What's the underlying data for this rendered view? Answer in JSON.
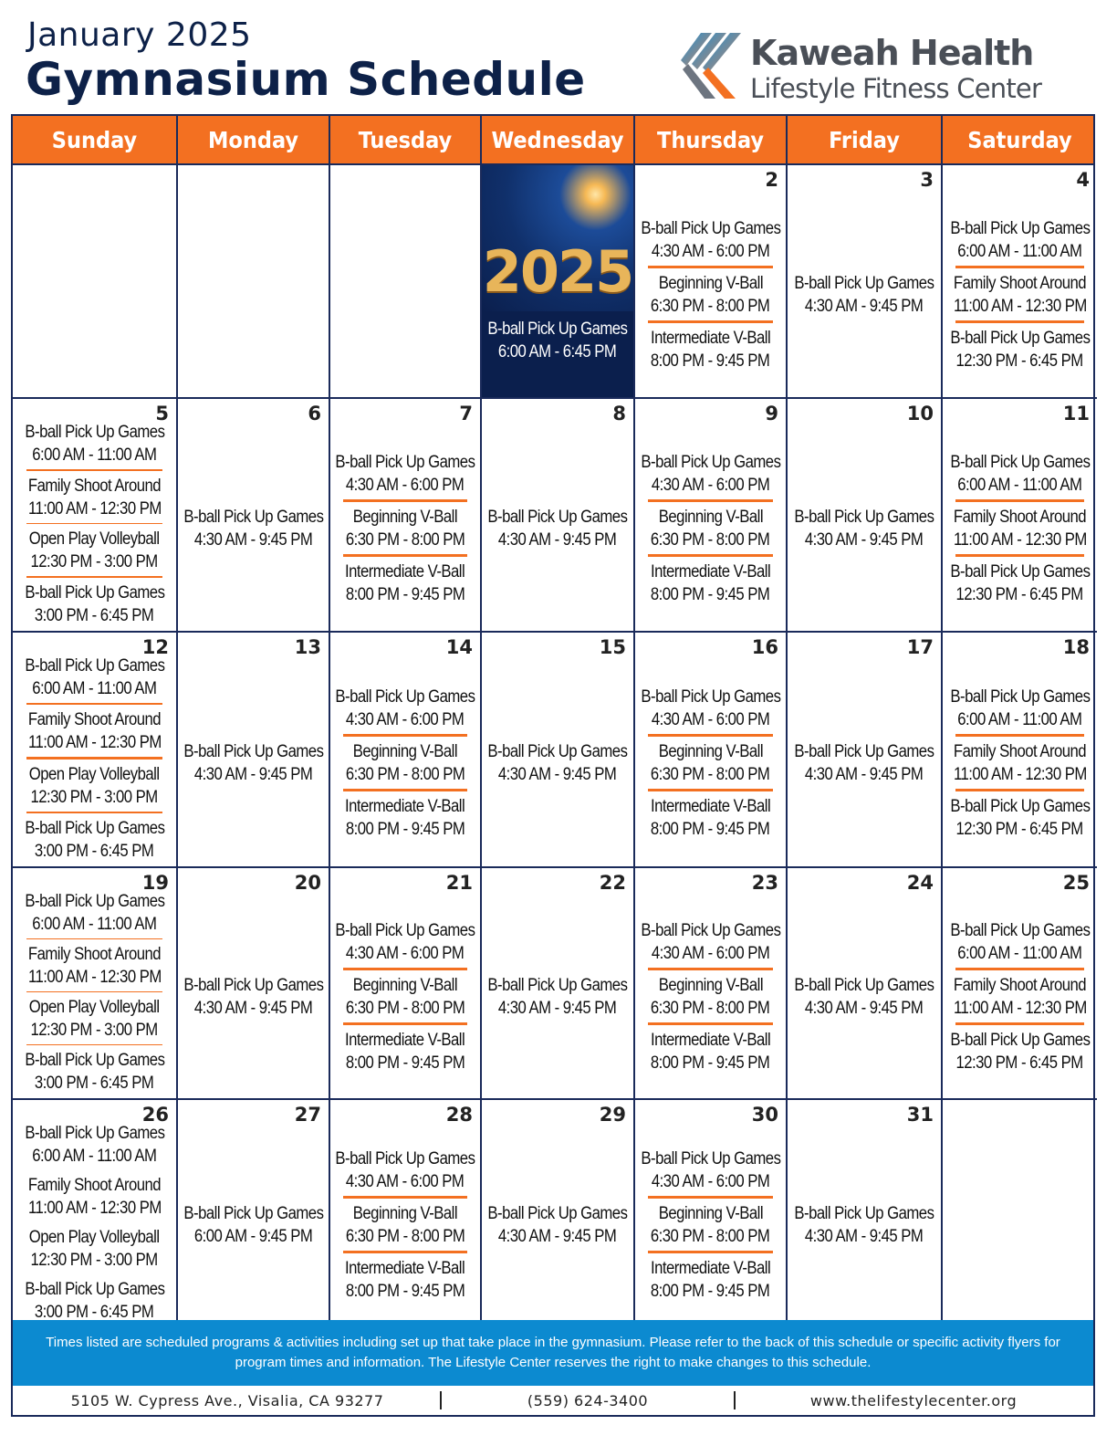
{
  "header": {
    "month": "January 2025",
    "title": "Gymnasium Schedule",
    "logo_line1": "Kaweah Health",
    "logo_line2": "Lifestyle Fitness Center",
    "logo_icon": "kaweah-k-stripes-icon"
  },
  "colors": {
    "accent": "#f37021",
    "navy": "#0d2148",
    "note_bg": "#0c8ad0",
    "border": "#1a2a5a"
  },
  "weekdays": [
    "Sunday",
    "Monday",
    "Tuesday",
    "Wednesday",
    "Thursday",
    "Friday",
    "Saturday"
  ],
  "weeks": [
    [
      {
        "day": "",
        "events": []
      },
      {
        "day": "",
        "events": []
      },
      {
        "day": "",
        "events": []
      },
      {
        "day": "",
        "special": "2025",
        "events": [
          [
            "B-ball Pick Up Games",
            "6:00 AM - 6:45 PM"
          ]
        ]
      },
      {
        "day": "2",
        "events": [
          [
            "B-ball Pick Up Games",
            "4:30 AM - 6:00 PM"
          ],
          [
            "Beginning V-Ball",
            "6:30 PM - 8:00 PM"
          ],
          [
            "Intermediate V-Ball",
            "8:00 PM - 9:45 PM"
          ]
        ]
      },
      {
        "day": "3",
        "events": [
          [
            "B-ball Pick Up Games",
            "4:30 AM - 9:45 PM"
          ]
        ]
      },
      {
        "day": "4",
        "events": [
          [
            "B-ball Pick Up Games",
            "6:00 AM - 11:00 AM"
          ],
          [
            "Family Shoot Around",
            "11:00 AM - 12:30 PM"
          ],
          [
            "B-ball Pick Up Games",
            "12:30 PM - 6:45 PM"
          ]
        ]
      }
    ],
    [
      {
        "day": "5",
        "events": [
          [
            "B-ball Pick Up Games",
            "6:00 AM - 11:00 AM"
          ],
          [
            "Family Shoot Around",
            "11:00 AM - 12:30 PM"
          ],
          [
            "Open Play Volleyball",
            "12:30 PM - 3:00 PM"
          ],
          [
            "B-ball Pick Up Games",
            "3:00 PM - 6:45 PM"
          ]
        ]
      },
      {
        "day": "6",
        "events": [
          [
            "B-ball Pick Up Games",
            "4:30 AM - 9:45 PM"
          ]
        ]
      },
      {
        "day": "7",
        "events": [
          [
            "B-ball Pick Up Games",
            "4:30 AM - 6:00 PM"
          ],
          [
            "Beginning V-Ball",
            "6:30 PM - 8:00 PM"
          ],
          [
            "Intermediate V-Ball",
            "8:00 PM - 9:45 PM"
          ]
        ]
      },
      {
        "day": "8",
        "events": [
          [
            "B-ball Pick Up Games",
            "4:30 AM - 9:45 PM"
          ]
        ]
      },
      {
        "day": "9",
        "events": [
          [
            "B-ball Pick Up Games",
            "4:30 AM - 6:00 PM"
          ],
          [
            "Beginning V-Ball",
            "6:30 PM - 8:00 PM"
          ],
          [
            "Intermediate V-Ball",
            "8:00 PM - 9:45 PM"
          ]
        ]
      },
      {
        "day": "10",
        "events": [
          [
            "B-ball Pick Up Games",
            "4:30 AM - 9:45 PM"
          ]
        ]
      },
      {
        "day": "11",
        "events": [
          [
            "B-ball Pick Up Games",
            "6:00 AM - 11:00 AM"
          ],
          [
            "Family Shoot Around",
            "11:00 AM - 12:30 PM"
          ],
          [
            "B-ball Pick Up Games",
            "12:30 PM - 6:45 PM"
          ]
        ]
      }
    ],
    [
      {
        "day": "12",
        "events": [
          [
            "B-ball Pick Up Games",
            "6:00 AM - 11:00 AM"
          ],
          [
            "Family Shoot Around",
            "11:00 AM - 12:30 PM"
          ],
          [
            "Open Play Volleyball",
            "12:30 PM - 3:00 PM"
          ],
          [
            "B-ball Pick Up Games",
            "3:00 PM - 6:45 PM"
          ]
        ]
      },
      {
        "day": "13",
        "events": [
          [
            "B-ball Pick Up Games",
            "4:30 AM - 9:45 PM"
          ]
        ]
      },
      {
        "day": "14",
        "events": [
          [
            "B-ball Pick Up Games",
            "4:30 AM - 6:00 PM"
          ],
          [
            "Beginning V-Ball",
            "6:30 PM - 8:00 PM"
          ],
          [
            "Intermediate V-Ball",
            "8:00 PM - 9:45 PM"
          ]
        ]
      },
      {
        "day": "15",
        "events": [
          [
            "B-ball Pick Up Games",
            "4:30 AM - 9:45 PM"
          ]
        ]
      },
      {
        "day": "16",
        "events": [
          [
            "B-ball Pick Up Games",
            "4:30 AM - 6:00 PM"
          ],
          [
            "Beginning V-Ball",
            "6:30 PM - 8:00 PM"
          ],
          [
            "Intermediate V-Ball",
            "8:00 PM - 9:45 PM"
          ]
        ]
      },
      {
        "day": "17",
        "events": [
          [
            "B-ball Pick Up Games",
            "4:30 AM - 9:45 PM"
          ]
        ]
      },
      {
        "day": "18",
        "events": [
          [
            "B-ball Pick Up Games",
            "6:00 AM - 11:00 AM"
          ],
          [
            "Family Shoot Around",
            "11:00 AM - 12:30 PM"
          ],
          [
            "B-ball Pick Up Games",
            "12:30 PM - 6:45 PM"
          ]
        ]
      }
    ],
    [
      {
        "day": "19",
        "events": [
          [
            "B-ball Pick Up Games",
            "6:00 AM - 11:00 AM"
          ],
          [
            "Family Shoot Around",
            "11:00 AM - 12:30 PM"
          ],
          [
            "Open Play Volleyball",
            "12:30 PM - 3:00 PM"
          ],
          [
            "B-ball Pick Up Games",
            "3:00 PM - 6:45 PM"
          ]
        ]
      },
      {
        "day": "20",
        "events": [
          [
            "B-ball Pick Up Games",
            "4:30 AM - 9:45 PM"
          ]
        ]
      },
      {
        "day": "21",
        "events": [
          [
            "B-ball Pick Up Games",
            "4:30 AM - 6:00 PM"
          ],
          [
            "Beginning V-Ball",
            "6:30 PM - 8:00 PM"
          ],
          [
            "Intermediate V-Ball",
            "8:00 PM - 9:45 PM"
          ]
        ]
      },
      {
        "day": "22",
        "events": [
          [
            "B-ball Pick Up Games",
            "4:30 AM - 9:45 PM"
          ]
        ]
      },
      {
        "day": "23",
        "events": [
          [
            "B-ball Pick Up Games",
            "4:30 AM - 6:00 PM"
          ],
          [
            "Beginning V-Ball",
            "6:30 PM - 8:00 PM"
          ],
          [
            "Intermediate V-Ball",
            "8:00 PM - 9:45 PM"
          ]
        ]
      },
      {
        "day": "24",
        "events": [
          [
            "B-ball Pick Up Games",
            "4:30 AM - 9:45 PM"
          ]
        ]
      },
      {
        "day": "25",
        "events": [
          [
            "B-ball Pick Up Games",
            "6:00 AM - 11:00 AM"
          ],
          [
            "Family Shoot Around",
            "11:00 AM - 12:30 PM"
          ],
          [
            "B-ball Pick Up Games",
            "12:30 PM - 6:45 PM"
          ]
        ]
      }
    ],
    [
      {
        "day": "26",
        "events": [
          [
            "B-ball Pick Up Games",
            "6:00 AM - 11:00 AM"
          ],
          [
            "Family Shoot Around",
            "11:00 AM - 12:30 PM"
          ],
          [
            "Open Play Volleyball",
            "12:30 PM - 3:00 PM"
          ],
          [
            "B-ball Pick Up Games",
            "3:00 PM - 6:45 PM"
          ]
        ]
      },
      {
        "day": "27",
        "events": [
          [
            "B-ball Pick Up Games",
            "6:00 AM - 9:45 PM"
          ]
        ]
      },
      {
        "day": "28",
        "events": [
          [
            "B-ball Pick Up Games",
            "4:30 AM - 6:00 PM"
          ],
          [
            "Beginning V-Ball",
            "6:30 PM - 8:00 PM"
          ],
          [
            "Intermediate V-Ball",
            "8:00 PM - 9:45 PM"
          ]
        ]
      },
      {
        "day": "29",
        "events": [
          [
            "B-ball Pick Up Games",
            "4:30 AM - 9:45 PM"
          ]
        ]
      },
      {
        "day": "30",
        "events": [
          [
            "B-ball Pick Up Games",
            "4:30 AM - 6:00 PM"
          ],
          [
            "Beginning V-Ball",
            "6:30 PM - 8:00 PM"
          ],
          [
            "Intermediate V-Ball",
            "8:00 PM - 9:45 PM"
          ]
        ]
      },
      {
        "day": "31",
        "events": [
          [
            "B-ball Pick Up Games",
            "4:30 AM - 9:45 PM"
          ]
        ]
      },
      {
        "day": "",
        "events": []
      }
    ]
  ],
  "note": "Times listed are scheduled programs & activities including set up that take place in the gymnasium. Please refer to the back of this schedule or specific activity flyers for program times and information.  The Lifestyle Center reserves the right to make changes to this schedule.",
  "footer": {
    "address": "5105 W. Cypress Ave.,  Visalia, CA 93277",
    "phone": "(559) 624-3400",
    "website": "www.thelifestylecenter.org"
  }
}
